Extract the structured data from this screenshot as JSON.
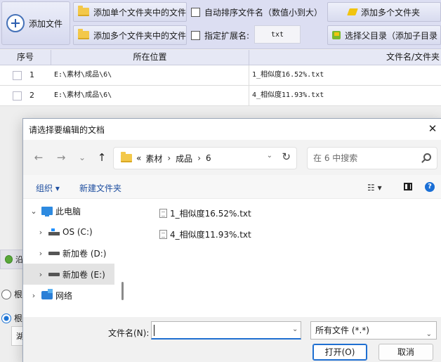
{
  "app": {
    "toolbar": {
      "add_file_label": "添加文件",
      "add_single_folder_label": "添加单个文件夹中的文件",
      "add_multi_folder_label": "添加多个文件夹中的文件",
      "auto_sort_label": "自动排序文件名（数值小到大）",
      "specify_ext_label": "指定扩展名:",
      "ext_value": "txt",
      "add_multi_folders_label": "添加多个文件夹",
      "select_parent_label": "选择父目录（添加子目录"
    },
    "grid": {
      "columns": [
        "序号",
        "所在位置",
        "文件名/文件夹"
      ],
      "rows": [
        {
          "num": "1",
          "location": "E:\\素材\\成品\\6\\",
          "filename": "1_相似度16.52%.txt"
        },
        {
          "num": "2",
          "location": "E:\\素材\\成品\\6\\",
          "filename": "4_相似度11.93%.txt"
        }
      ]
    },
    "lower": {
      "strip_text": "沿",
      "radio1_label": "根",
      "radio2_label": "根",
      "input_text": "湖"
    }
  },
  "dialog": {
    "title": "请选择要编辑的文档",
    "close_glyph": "✕",
    "nav": {
      "back_glyph": "←",
      "forward_glyph": "→",
      "recent_glyph": "⌄",
      "up_glyph": "↑",
      "address_prefix": "«",
      "breadcrumb": [
        "素材",
        "成品",
        "6"
      ],
      "sep_glyph": "›",
      "dropdown_glyph": "⌄",
      "refresh_glyph": "↻",
      "search_placeholder": "在 6 中搜索"
    },
    "commands": {
      "organize": "组织 ▾",
      "new_folder": "新建文件夹",
      "view_glyph": "☷ ▾",
      "help_glyph": "?"
    },
    "tree": [
      {
        "chevron": "⌄",
        "label": "此电脑"
      },
      {
        "chevron": "›",
        "label": "OS (C:)"
      },
      {
        "chevron": "›",
        "label": "新加卷 (D:)"
      },
      {
        "chevron": "›",
        "label": "新加卷 (E:)"
      },
      {
        "chevron": "›",
        "label": "网络"
      }
    ],
    "files": [
      "1_相似度16.52%.txt",
      "4_相似度11.93%.txt"
    ],
    "filename_label": "文件名(N):",
    "filename_value": "",
    "filetype_value": "所有文件 (*.*)",
    "open_label": "打开(O)",
    "cancel_label": "取消",
    "dropdown_glyph": "⌄"
  }
}
